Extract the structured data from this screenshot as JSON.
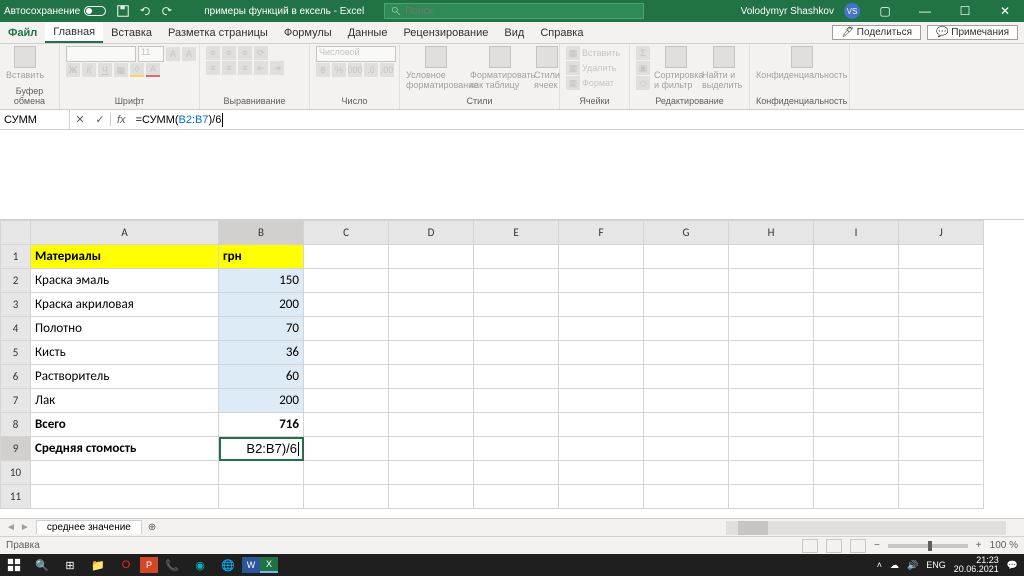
{
  "titlebar": {
    "autosave": "Автосохранение",
    "doc_name": "примеры функций в ексель - Excel",
    "search_placeholder": "Поиск",
    "user": "Volodymyr Shashkov",
    "user_initials": "VS"
  },
  "tabs": {
    "file": "Файл",
    "items": [
      "Главная",
      "Вставка",
      "Разметка страницы",
      "Формулы",
      "Данные",
      "Рецензирование",
      "Вид",
      "Справка"
    ],
    "active_index": 0,
    "share": "Поделиться",
    "comments": "Примечания"
  },
  "ribbon": {
    "groups": {
      "clipboard": {
        "label": "Буфер обмена",
        "paste": "Вставить"
      },
      "font": {
        "label": "Шрифт",
        "size": "11"
      },
      "alignment": {
        "label": "Выравнивание"
      },
      "number": {
        "label": "Число",
        "format": "Числовой"
      },
      "styles": {
        "label": "Стили",
        "cond": "Условное форматирование",
        "fmt_table": "Форматировать как таблицу",
        "cell_styles": "Стили ячеек"
      },
      "cells": {
        "label": "Ячейки",
        "insert": "Вставить",
        "delete": "Удалить",
        "format": "Формат"
      },
      "editing": {
        "label": "Редактирование",
        "sort": "Сортировка и фильтр",
        "find": "Найти и выделить"
      },
      "sensitivity": {
        "label": "Конфиденциальность",
        "btn": "Конфиденциальность"
      }
    }
  },
  "formula_bar": {
    "name_box": "СУММ",
    "formula_prefix": "=СУММ(",
    "formula_ref": "B2:B7",
    "formula_suffix": ")/6"
  },
  "chart_data": {
    "type": "table",
    "columns": [
      "Материалы",
      "грн"
    ],
    "rows": [
      {
        "label": "Краска эмаль",
        "value": 150
      },
      {
        "label": "Краска акриловая",
        "value": 200
      },
      {
        "label": "Полотно",
        "value": 70
      },
      {
        "label": "Кисть",
        "value": 36
      },
      {
        "label": "Растворитель",
        "value": 60
      },
      {
        "label": "Лак",
        "value": 200
      }
    ],
    "total_label": "Всего",
    "total_value": 716,
    "avg_label": "Средняя стомость",
    "avg_display": "B2:B7)/6"
  },
  "grid": {
    "col_letters": [
      "A",
      "B",
      "C",
      "D",
      "E",
      "F",
      "G",
      "H",
      "I",
      "J"
    ],
    "row_count": 11
  },
  "sheet": {
    "tab_name": "среднее значение",
    "status": "Правка",
    "zoom": "100 %"
  },
  "taskbar": {
    "lang": "ENG",
    "time": "21:23",
    "date": "20.06.2021"
  }
}
